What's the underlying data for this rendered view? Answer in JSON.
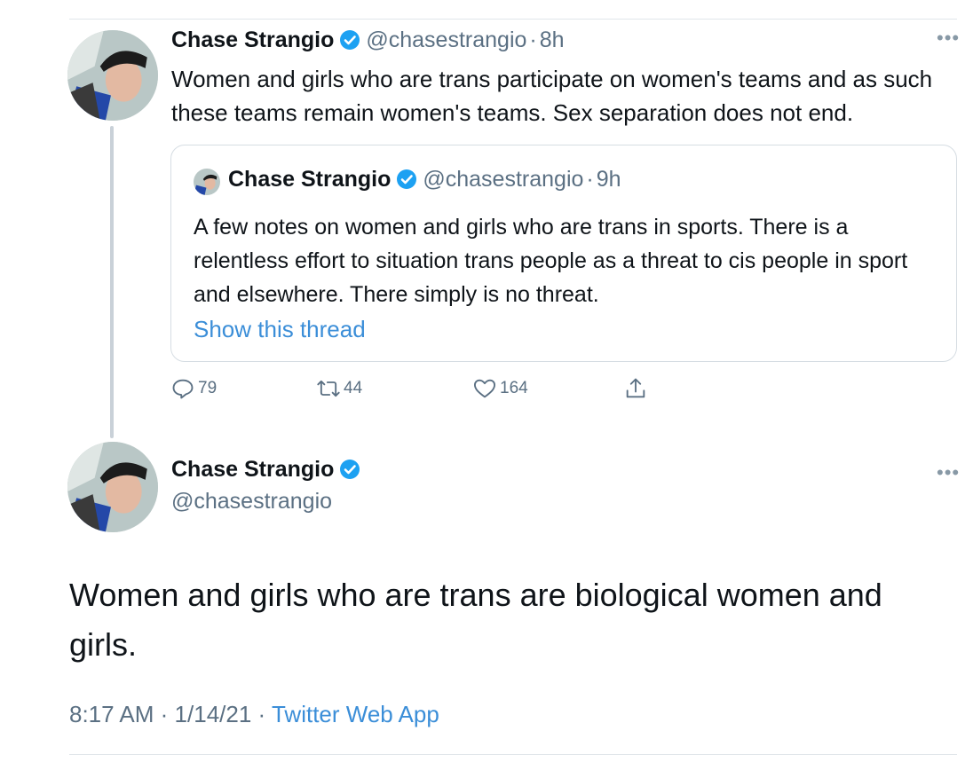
{
  "reply": {
    "name": "Chase Strangio",
    "handle": "@chasestrangio",
    "separator": "·",
    "time": "8h",
    "text": "Women and girls who are trans participate on women's teams and as such these teams remain women's teams. Sex separation does not end."
  },
  "quoted": {
    "name": "Chase Strangio",
    "handle": "@chasestrangio",
    "separator": "·",
    "time": "9h",
    "text": "A few notes on women and girls who are trans in sports. There is a relentless effort to situation trans people as a threat to cis people in sport and elsewhere. There simply is no threat.",
    "show_thread": "Show this thread"
  },
  "actions": {
    "replies": "79",
    "retweets": "44",
    "likes": "164",
    "icons": [
      "reply-icon",
      "retweet-icon",
      "like-icon",
      "share-icon"
    ]
  },
  "main_tweet": {
    "name": "Chase Strangio",
    "handle": "@chasestrangio",
    "text": "Women and girls who are trans are biological women and girls.",
    "time": "8:17 AM",
    "sep1": "·",
    "date": "1/14/21",
    "sep2": "·",
    "source": "Twitter Web App"
  },
  "colors": {
    "link": "#3b8ed8",
    "verified": "#1da1f2",
    "secondary_text": "#5b7083",
    "border": "#d6dde3"
  }
}
